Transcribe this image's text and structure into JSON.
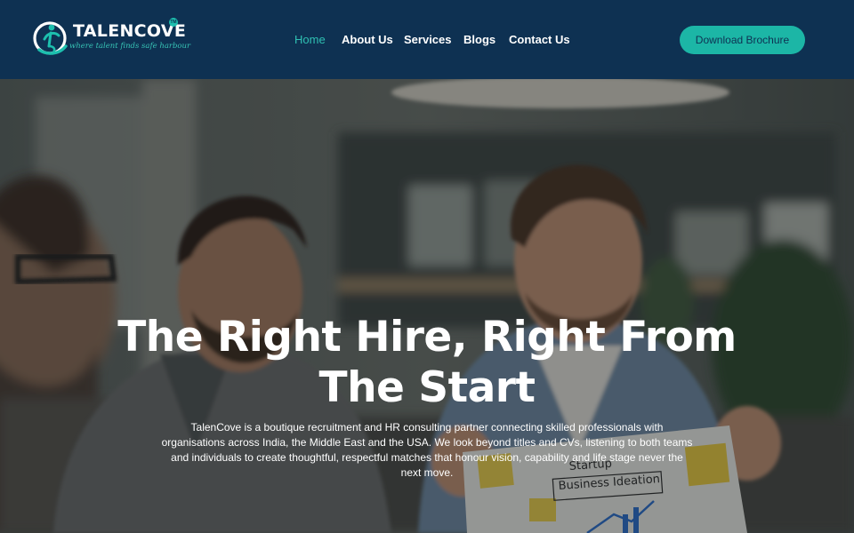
{
  "brand": {
    "name": "TALENCOVE",
    "tm": "TM",
    "tagline": "where talent finds safe harbour"
  },
  "nav": {
    "items": [
      {
        "label": "Home",
        "active": true
      },
      {
        "label": "About Us",
        "active": false
      },
      {
        "label": "Services",
        "active": false
      },
      {
        "label": "Blogs",
        "active": false
      },
      {
        "label": "Contact Us",
        "active": false
      }
    ]
  },
  "header": {
    "cta_label": "Download Brochure"
  },
  "hero": {
    "title": "The Right Hire, Right From The Start",
    "description": "TalenCove is a boutique recruitment and HR consulting partner connecting skilled professionals with organisations across India, the Middle East and the USA. We look beyond titles and CVs, listening to both teams and individuals to create thoughtful, respectful matches that honour vision, capability and life stage never the next move.",
    "photo_board_text": "Startup Business Ideation"
  },
  "colors": {
    "header_bg": "#0e3152",
    "accent": "#1cb6a6",
    "nav_active": "#2fc0b2",
    "text_light": "#ffffff"
  },
  "icons": [
    "logo-mark-icon"
  ]
}
